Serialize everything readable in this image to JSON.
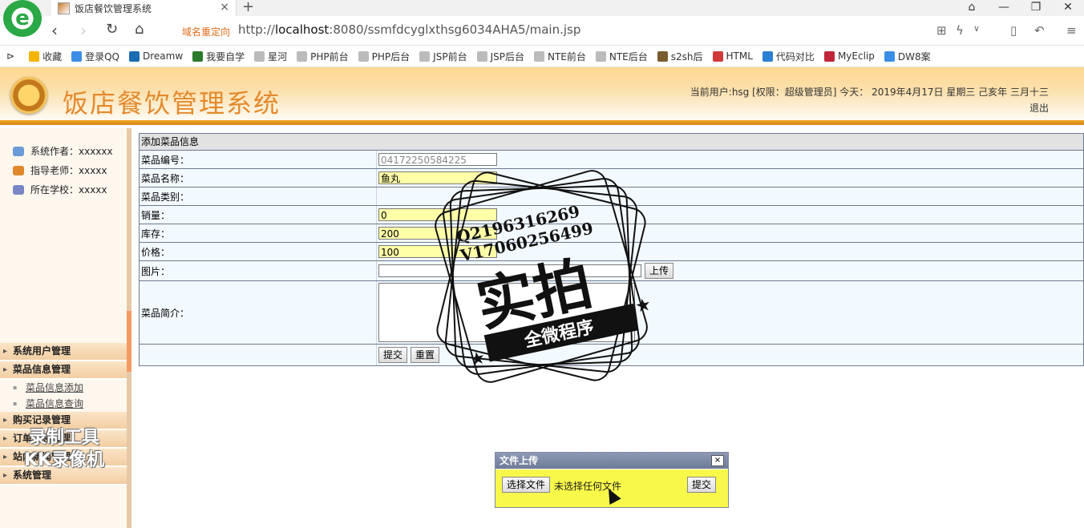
{
  "browser": {
    "tab_title": "饭店餐饮管理系统",
    "tab_close": "×",
    "new_tab": "+",
    "redirect_label": "域名重定向",
    "url_prefix": "http://",
    "url_host": "localhost",
    "url_rest": ":8080/ssmfdcyglxthsg6034AHA5/main.jsp",
    "bookmarks": [
      {
        "label": "收藏",
        "color": "#f3b400"
      },
      {
        "label": "登录QQ",
        "color": "#3a8ee6"
      },
      {
        "label": "Dreamw",
        "color": "#1b6cb3"
      },
      {
        "label": "我要自学",
        "color": "#2b7a2b"
      },
      {
        "label": "星河",
        "color": "#bbbbbb"
      },
      {
        "label": "PHP前台",
        "color": "#bbbbbb"
      },
      {
        "label": "PHP后台",
        "color": "#bbbbbb"
      },
      {
        "label": "JSP前台",
        "color": "#bbbbbb"
      },
      {
        "label": "JSP后台",
        "color": "#bbbbbb"
      },
      {
        "label": "NTE前台",
        "color": "#bbbbbb"
      },
      {
        "label": "NTE后台",
        "color": "#bbbbbb"
      },
      {
        "label": "s2sh后",
        "color": "#7a5c2e"
      },
      {
        "label": "HTML",
        "color": "#d03a3a"
      },
      {
        "label": "代码对比",
        "color": "#2a7fd4"
      },
      {
        "label": "MyEclip",
        "color": "#c0273a"
      },
      {
        "label": "DW8案",
        "color": "#3a8ee6"
      }
    ]
  },
  "header": {
    "title": "饭店餐饮管理系统",
    "user_info": "当前用户:hsg [权限：超级管理员] 今天： 2019年4月17日 星期三 己亥年 三月十三",
    "logout": "退出"
  },
  "sidebar": {
    "info": [
      {
        "label": "系统作者：xxxxxx",
        "color": "#6a9bd6"
      },
      {
        "label": "指导老师：xxxxx",
        "color": "#e0882b"
      },
      {
        "label": "所在学校：xxxxx",
        "color": "#7a86c4"
      }
    ],
    "menu": [
      {
        "label": "系统用户管理"
      },
      {
        "label": "菜品信息管理"
      }
    ],
    "sub_items": [
      "菜品信息添加",
      "菜品信息查询"
    ],
    "menu2": [
      "购买记录管理",
      "订单信息管理",
      "站内新闻管理",
      "系统管理"
    ],
    "watermark_line1": "录制工具",
    "watermark_line2": "KK录像机"
  },
  "form": {
    "heading": "添加菜品信息",
    "rows": {
      "code_label": "菜品编号：",
      "code_value": "04172250584225",
      "name_label": "菜品名称：",
      "name_value": "鱼丸",
      "category_label": "菜品类别：",
      "sales_label": "销量：",
      "sales_value": "0",
      "stock_label": "库存：",
      "stock_value": "200",
      "price_label": "价格：",
      "price_value": "100",
      "image_label": "图片：",
      "upload_btn": "上传",
      "intro_label": "菜品简介："
    },
    "submit": "提交",
    "reset": "重置"
  },
  "stamp": {
    "line1": "Q2196316269",
    "line2": "V17060256499",
    "main": "实拍",
    "banner": "全微程序"
  },
  "dialog": {
    "title": "文件上传",
    "close": "×",
    "choose": "选择文件",
    "no_file": "未选择任何文件",
    "submit": "提交"
  }
}
